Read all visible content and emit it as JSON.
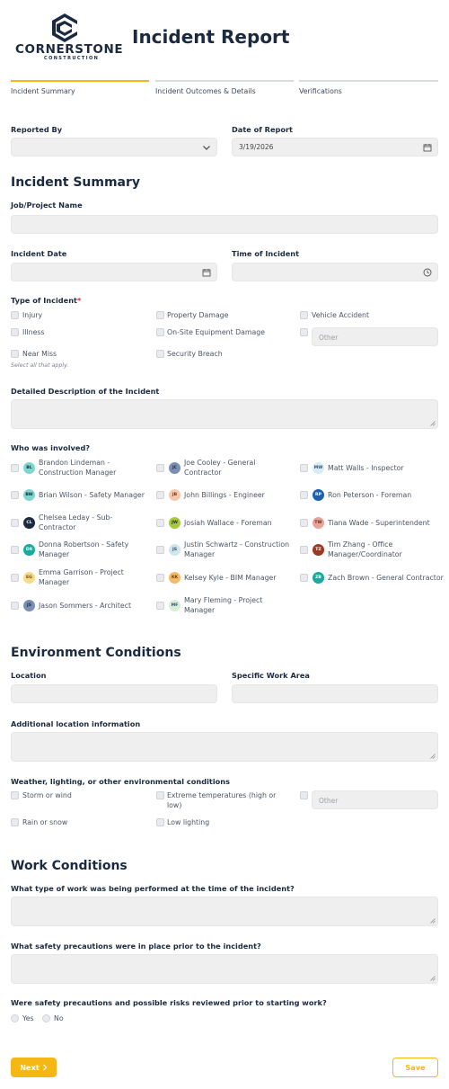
{
  "brand": {
    "name": "CORNERSTONE",
    "tagline": "CONSTRUCTION",
    "color": "#1b2a3f",
    "accent": "#f5b715"
  },
  "title": "Incident Report",
  "steps": [
    {
      "label": "Incident Summary",
      "active": true
    },
    {
      "label": "Incident Outcomes & Details",
      "active": false
    },
    {
      "label": "Verifications",
      "active": false
    }
  ],
  "reported_by": {
    "label": "Reported By",
    "value": ""
  },
  "date_of_report": {
    "label": "Date of Report",
    "value": "3/19/2026"
  },
  "incident_summary": {
    "heading": "Incident Summary",
    "job_label": "Job/Project Name",
    "incident_date_label": "Incident Date",
    "time_label": "Time of Incident",
    "type_label": "Type of Incident",
    "required_mark": "*",
    "types": [
      "Injury",
      "Property Damage",
      "Vehicle Accident",
      "Illness",
      "On-Site Equipment Damage",
      "Near Miss",
      "Security Breach"
    ],
    "other_placeholder": "Other",
    "help": "Select all that apply.",
    "description_label": "Detailed Description of the Incident"
  },
  "involved": {
    "label": "Who was involved?",
    "people": [
      {
        "initials": "BL",
        "name": "Brandon Lindeman - Construction Manager",
        "bg": "#7fd6cf",
        "fg": "#1b2a3f"
      },
      {
        "initials": "JC",
        "name": "Joe Cooley - General Contractor",
        "bg": "#7b8fb5",
        "fg": "#1b2a3f"
      },
      {
        "initials": "MW",
        "name": "Matt Walls - Inspector",
        "bg": "#d8ecf6",
        "fg": "#33506b"
      },
      {
        "initials": "BW",
        "name": "Brian Wilson - Safety Manager",
        "bg": "#7fd6cf",
        "fg": "#1b2a3f"
      },
      {
        "initials": "JB",
        "name": "John Billings - Engineer",
        "bg": "#f3c9b0",
        "fg": "#7a3a1a"
      },
      {
        "initials": "RP",
        "name": "Ron Peterson - Foreman",
        "bg": "#1e5fae",
        "fg": "#ffffff"
      },
      {
        "initials": "CL",
        "name": "Chelsea Leday - Sub-Contractor",
        "bg": "#1b2a3f",
        "fg": "#ffffff"
      },
      {
        "initials": "JW",
        "name": "Josiah Wallace - Foreman",
        "bg": "#a7c93c",
        "fg": "#1b2a3f"
      },
      {
        "initials": "TW",
        "name": "Tiana Wade - Superintendent",
        "bg": "#e8a39a",
        "fg": "#6b2a22"
      },
      {
        "initials": "DR",
        "name": "Donna Robertson - Safety Manager",
        "bg": "#1aa99b",
        "fg": "#ffffff"
      },
      {
        "initials": "JS",
        "name": "Justin Schwartz - Construction Manager",
        "bg": "#cfe7ea",
        "fg": "#33506b"
      },
      {
        "initials": "TZ",
        "name": "Tim Zhang - Office Manager/Coordinator",
        "bg": "#9b3a22",
        "fg": "#ffffff"
      },
      {
        "initials": "EG",
        "name": "Emma Garrison - Project Manager",
        "bg": "#f6dc8a",
        "fg": "#6b5010"
      },
      {
        "initials": "KK",
        "name": "Kelsey Kyle - BIM Manager",
        "bg": "#f4b96a",
        "fg": "#6b3a10"
      },
      {
        "initials": "ZB",
        "name": "Zach Brown - General Contractor",
        "bg": "#1aa99b",
        "fg": "#ffffff"
      },
      {
        "initials": "JS",
        "name": "Jason Sommers - Architect",
        "bg": "#7b8fb5",
        "fg": "#1b2a3f"
      },
      {
        "initials": "MF",
        "name": "Mary Fleming - Project Manager",
        "bg": "#d7eed9",
        "fg": "#33506b"
      }
    ]
  },
  "environment": {
    "heading": "Environment Conditions",
    "location_label": "Location",
    "work_area_label": "Specific Work Area",
    "additional_label": "Additional location information",
    "weather_label": "Weather, lighting, or other environmental conditions",
    "options": [
      "Storm or wind",
      "Extreme temperatures (high or low)",
      "Rain or snow",
      "Low lighting"
    ],
    "other_placeholder": "Other"
  },
  "work": {
    "heading": "Work Conditions",
    "q1": "What type of work was being performed at the time of the incident?",
    "q2": "What safety precautions were in place prior to the incident?",
    "q3": "Were safety precautions and possible risks reviewed prior to starting work?",
    "yes": "Yes",
    "no": "No"
  },
  "buttons": {
    "next": "Next",
    "save": "Save"
  }
}
